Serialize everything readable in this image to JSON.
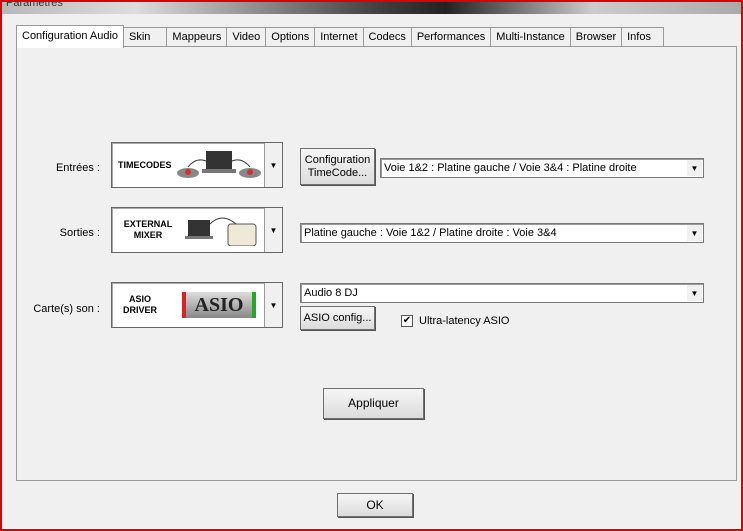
{
  "window": {
    "title": "Paramètres"
  },
  "tabs": [
    "Configuration Audio",
    "Skin",
    "Mappeurs",
    "Video",
    "Options",
    "Internet",
    "Codecs",
    "Performances",
    "Multi-Instance",
    "Browser",
    "Infos"
  ],
  "inputs": {
    "label": "Entrées :",
    "image_text": "TIMECODES",
    "button": "Configuration TimeCode...",
    "value": "Voie 1&2 : Platine gauche / Voie 3&4 : Platine droite"
  },
  "outputs": {
    "label": "Sorties :",
    "image_text": "EXTERNAL MIXER",
    "value": "Platine gauche : Voie 1&2 / Platine droite : Voie 3&4"
  },
  "soundcard": {
    "label": "Carte(s) son :",
    "image_text": "ASIO DRIVER",
    "logo": "ASIO",
    "value": "Audio 8 DJ",
    "button": "ASIO config...",
    "checkbox_label": "Ultra-latency ASIO",
    "checked": true
  },
  "apply_label": "Appliquer",
  "ok_label": "OK"
}
